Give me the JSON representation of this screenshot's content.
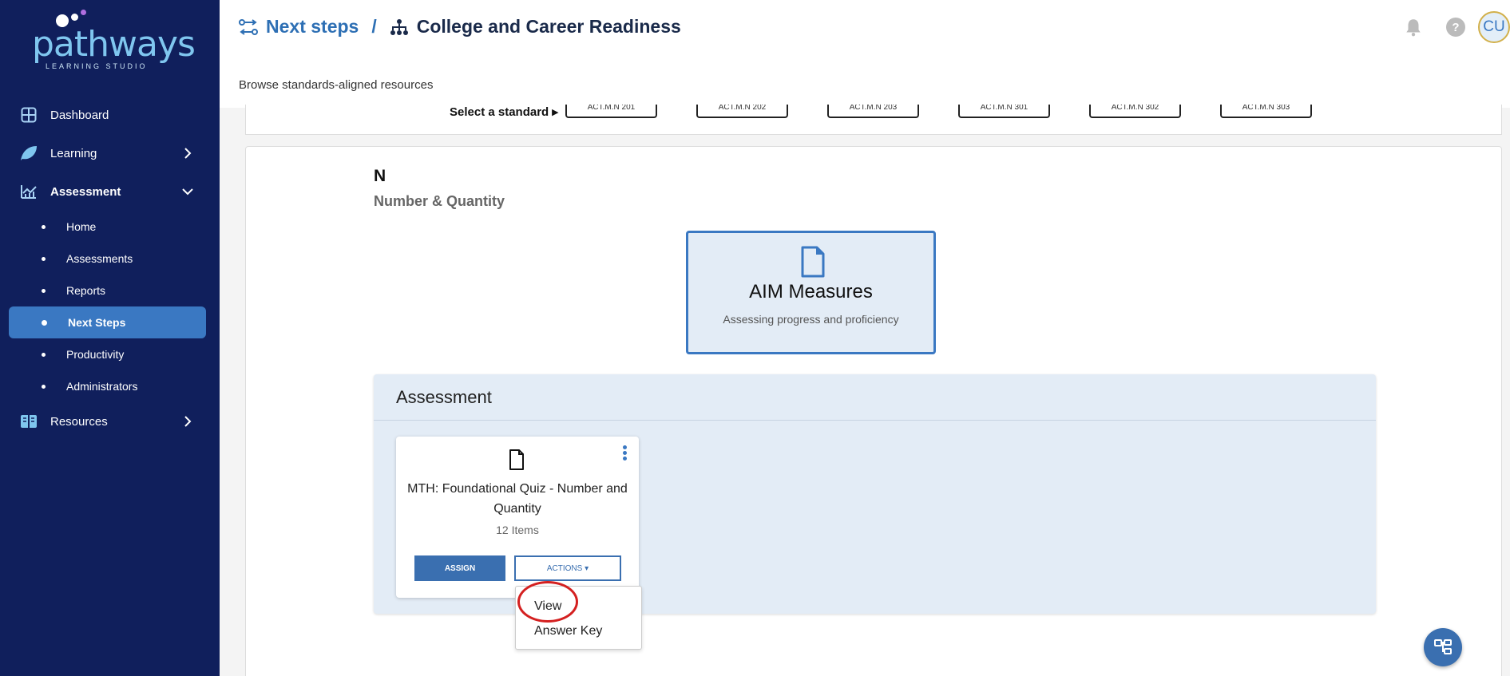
{
  "brand": {
    "name": "pathways",
    "tagline": "LEARNING STUDIO"
  },
  "sidebar": {
    "items": [
      {
        "label": "Dashboard",
        "icon": "dashboard-grid-icon"
      },
      {
        "label": "Learning",
        "icon": "leaf-icon",
        "expandable": true,
        "expanded": false
      },
      {
        "label": "Assessment",
        "icon": "chart-icon",
        "expandable": true,
        "expanded": true
      },
      {
        "label": "Resources",
        "icon": "book-icon",
        "expandable": true,
        "expanded": false
      }
    ],
    "assessment_sub": [
      {
        "label": "Home"
      },
      {
        "label": "Assessments"
      },
      {
        "label": "Reports"
      },
      {
        "label": "Next Steps",
        "active": true
      },
      {
        "label": "Productivity"
      },
      {
        "label": "Administrators"
      }
    ]
  },
  "header": {
    "crumb1": "Next steps",
    "separator": "/",
    "crumb2": "College and Career Readiness",
    "subtitle": "Browse standards-aligned resources",
    "avatar_initials": "CU",
    "help": "?"
  },
  "standards": {
    "label": "Select a standard ▸",
    "buttons": [
      "ACT.M.N 201",
      "ACT.M.N 202",
      "ACT.M.N 203",
      "ACT.M.N 301",
      "ACT.M.N 302",
      "ACT.M.N 303"
    ]
  },
  "section": {
    "code": "N",
    "name": "Number & Quantity"
  },
  "aim": {
    "title": "AIM Measures",
    "description": "Assessing progress and proficiency"
  },
  "assessment_panel": {
    "title": "Assessment",
    "card": {
      "title": "MTH: Foundational Quiz - Number and Quantity",
      "items": "12 Items",
      "assign_label": "ASSIGN",
      "actions_label": "ACTIONS ▾"
    }
  },
  "actions_menu": {
    "items": [
      "View",
      "Answer Key"
    ]
  },
  "colors": {
    "sidebar": "#101f5c",
    "accent": "#3a78c2",
    "highlight_circle": "#d42020"
  }
}
